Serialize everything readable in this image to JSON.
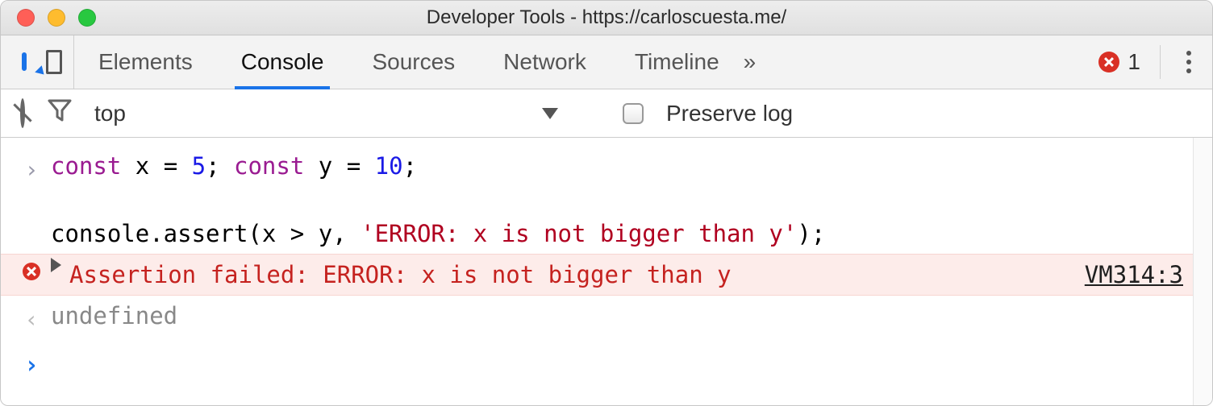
{
  "window": {
    "title": "Developer Tools - https://carloscuesta.me/"
  },
  "toolbar": {
    "tabs": [
      "Elements",
      "Console",
      "Sources",
      "Network",
      "Timeline"
    ],
    "active_index": 1,
    "overflow_glyph": "»",
    "error_count": "1"
  },
  "settings": {
    "context": "top",
    "preserve_label": "Preserve log",
    "preserve_checked": false
  },
  "console": {
    "input_line1_pre": "const",
    "input_line1_x": " x = ",
    "input_line1_five": "5",
    "input_line1_sep": "; ",
    "input_line1_pre2": "const",
    "input_line1_y": " y = ",
    "input_line1_ten": "10",
    "input_line1_end": ";",
    "input_line2_pre": "console.assert(x > y, ",
    "input_line2_str": "'ERROR: x is not bigger than y'",
    "input_line2_end": ");",
    "error_text": "Assertion failed: ERROR: x is not bigger than y",
    "error_source": "VM314:3",
    "result_text": "undefined"
  }
}
